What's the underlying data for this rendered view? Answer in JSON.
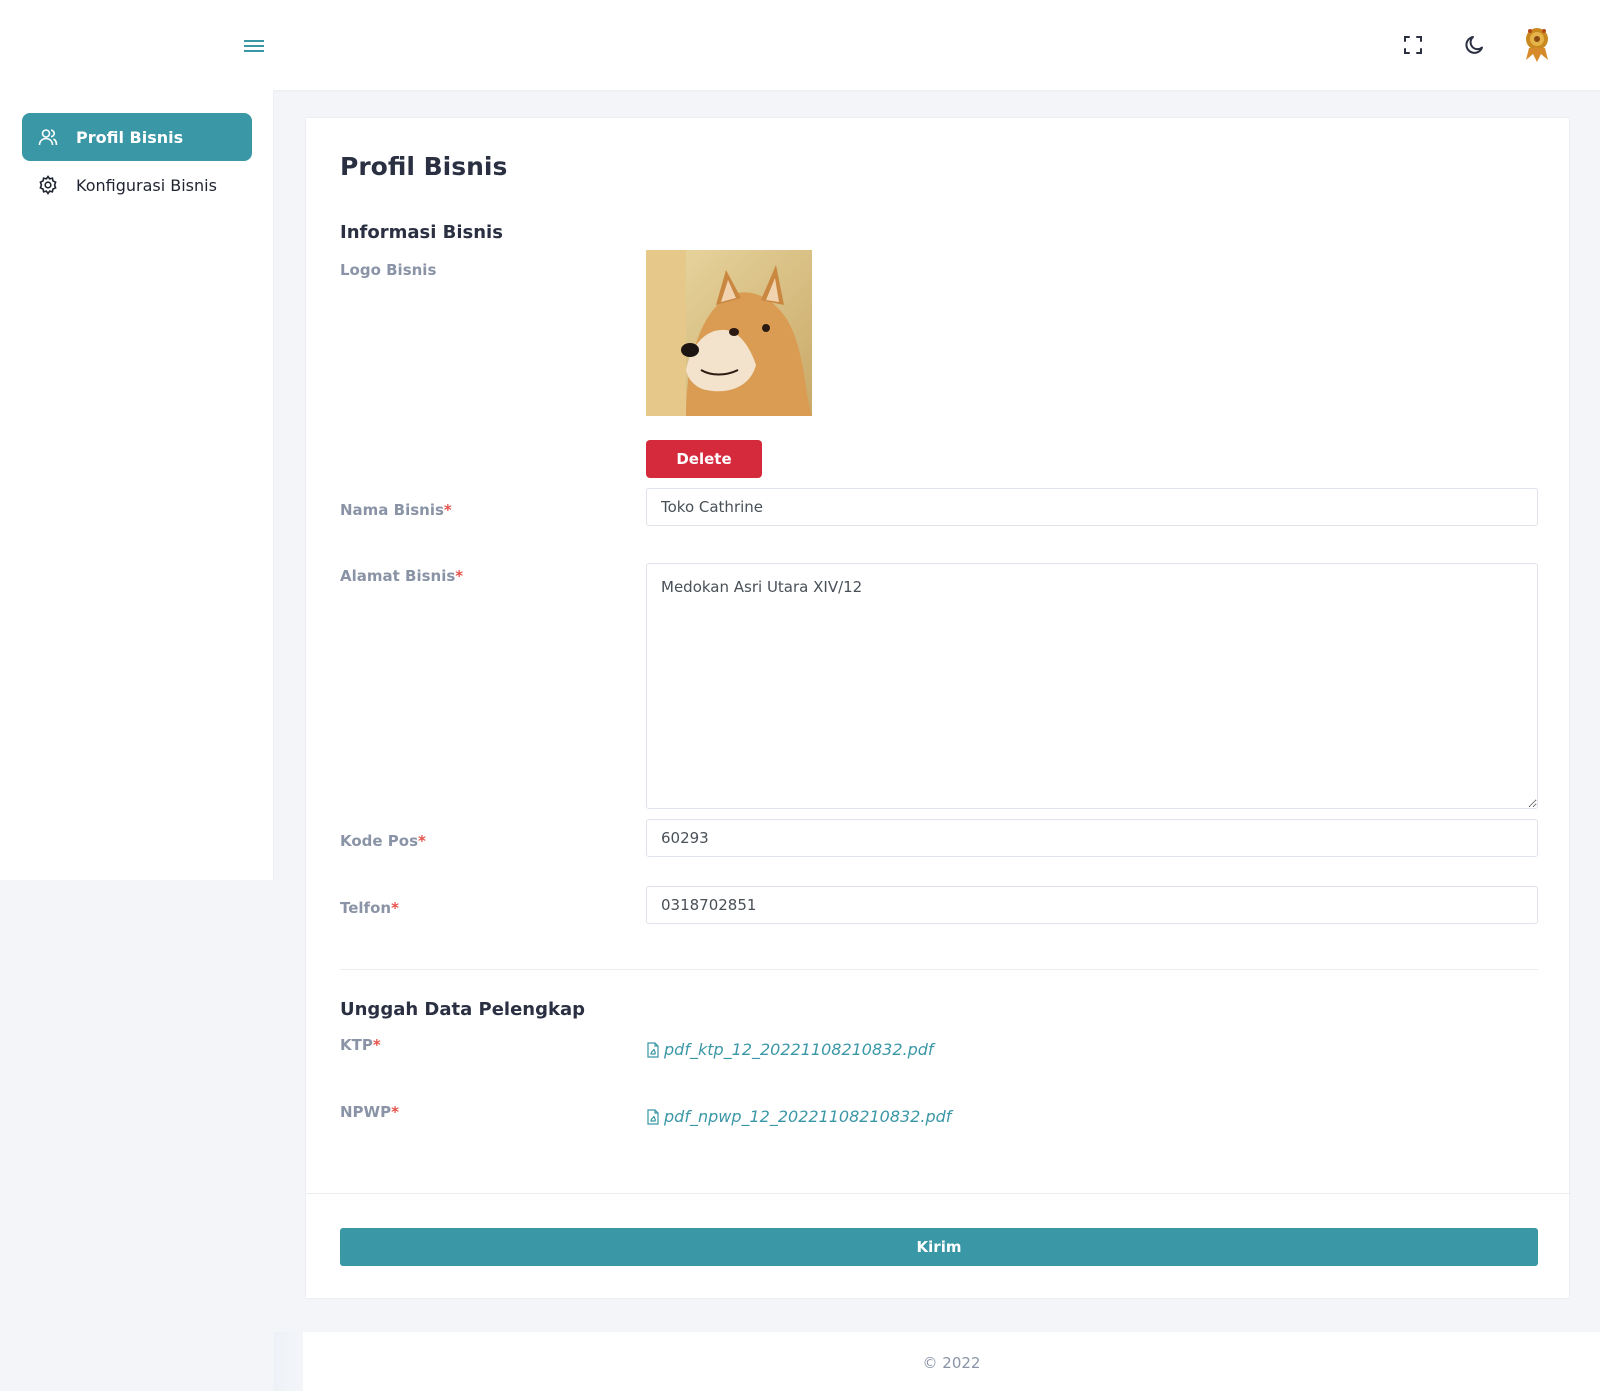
{
  "header": {
    "menu_icon": "hamburger-icon",
    "fullscreen_icon": "fullscreen-icon",
    "theme_icon": "moon-icon",
    "avatar_icon": "emblem-avatar"
  },
  "sidebar": {
    "items": [
      {
        "label": "Profil Bisnis",
        "icon": "users-icon",
        "active": true
      },
      {
        "label": "Konfigurasi Bisnis",
        "icon": "gear-icon",
        "active": false
      }
    ]
  },
  "page": {
    "title": "Profil Bisnis",
    "section_info": "Informasi Bisnis",
    "section_upload": "Unggah Data Pelengkap"
  },
  "form": {
    "logo_label": "Logo Bisnis",
    "delete_label": "Delete",
    "nama_label": "Nama Bisnis",
    "nama_value": "Toko Cathrine",
    "alamat_label": "Alamat Bisnis",
    "alamat_value": "Medokan Asri Utara XIV/12",
    "kodepos_label": "Kode Pos",
    "kodepos_value": "60293",
    "telfon_label": "Telfon",
    "telfon_value": "0318702851",
    "required_mark": "*",
    "ktp_label": "KTP",
    "ktp_file": "pdf_ktp_12_20221108210832.pdf",
    "npwp_label": "NPWP",
    "npwp_file": "pdf_npwp_12_20221108210832.pdf",
    "submit_label": "Kirim"
  },
  "footer": {
    "text": "© 2022"
  },
  "colors": {
    "primary": "#3a97a6",
    "danger": "#d42a3c",
    "required": "#e5534b"
  }
}
